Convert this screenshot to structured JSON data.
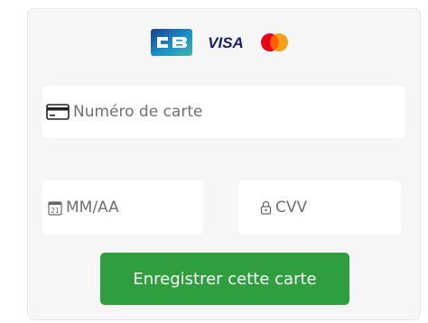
{
  "brands": [
    {
      "icon": "cb-card-icon"
    },
    {
      "icon": "visa-card-icon",
      "label": "VISA"
    },
    {
      "icon": "mastercard-icon"
    }
  ],
  "card_number": {
    "icon": "credit-card-icon",
    "placeholder": "Numéro de carte",
    "value": ""
  },
  "expiry": {
    "icon": "calendar-icon",
    "icon_text": "21",
    "placeholder": "MM/AA",
    "value": ""
  },
  "cvv": {
    "icon": "lock-icon",
    "placeholder": "CVV",
    "value": ""
  },
  "submit": {
    "label": "Enregistrer cette carte",
    "color": "#2f9e3e"
  },
  "colors": {
    "panel_background": "#f6f6f6",
    "field_background": "#ffffff",
    "placeholder_text": "#6f6f6f",
    "visa_blue": "#1a1f71",
    "mastercard_red": "#eb001b",
    "mastercard_orange": "#f79e1b"
  }
}
